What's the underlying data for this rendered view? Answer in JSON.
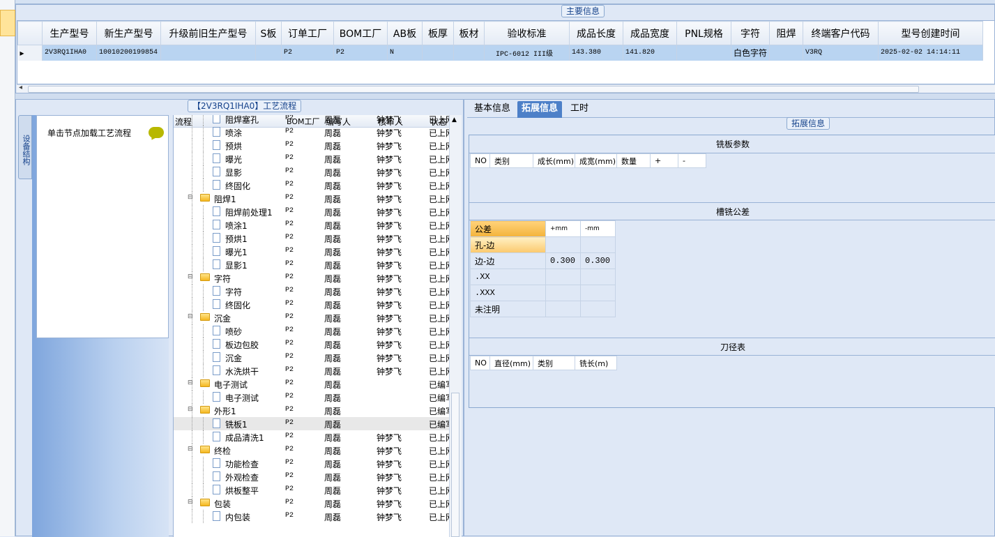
{
  "main_group_title": "主要信息",
  "grid": {
    "columns": [
      "生产型号",
      "新生产型号",
      "升级前旧生产型号",
      "S板",
      "订单工厂",
      "BOM工厂",
      "AB板",
      "板厚",
      "板材",
      "验收标准",
      "成品长度",
      "成品宽度",
      "PNL规格",
      "字符",
      "阻焊",
      "终端客户代码",
      "型号创建时间"
    ],
    "row": [
      "2V3RQ1IHA0",
      "10010200199854",
      "",
      "",
      "P2",
      "P2",
      "N",
      "",
      "",
      "IPC-6012 III级",
      "143.380",
      "141.820",
      "",
      "白色字符",
      "",
      "V3RQ",
      "2025-02-02 14:14:11"
    ]
  },
  "left": {
    "vtab_label": "设备结构",
    "load_hint": "单击节点加载工艺流程",
    "flow_title": "【2V3RQ1IHA0】工艺流程",
    "headers": {
      "flow": "流程",
      "bom": "BOM工厂",
      "writer": "编写人",
      "reviewer": "核审人",
      "status": "状态"
    },
    "rows": [
      {
        "name": "阻焊塞孔",
        "level": 2,
        "type": "doc",
        "bom": "P2",
        "writer": "周磊",
        "reviewer": "钟梦飞",
        "status": "已上网"
      },
      {
        "name": "喷涂",
        "level": 2,
        "type": "doc",
        "bom": "P2",
        "writer": "周磊",
        "reviewer": "钟梦飞",
        "status": "已上网"
      },
      {
        "name": "预烘",
        "level": 2,
        "type": "doc",
        "bom": "P2",
        "writer": "周磊",
        "reviewer": "钟梦飞",
        "status": "已上网"
      },
      {
        "name": "曝光",
        "level": 2,
        "type": "doc",
        "bom": "P2",
        "writer": "周磊",
        "reviewer": "钟梦飞",
        "status": "已上网"
      },
      {
        "name": "显影",
        "level": 2,
        "type": "doc",
        "bom": "P2",
        "writer": "周磊",
        "reviewer": "钟梦飞",
        "status": "已上网"
      },
      {
        "name": "终固化",
        "level": 2,
        "type": "doc",
        "bom": "P2",
        "writer": "周磊",
        "reviewer": "钟梦飞",
        "status": "已上网"
      },
      {
        "name": "阻焊1",
        "level": 1,
        "type": "folder",
        "bom": "P2",
        "writer": "周磊",
        "reviewer": "钟梦飞",
        "status": "已上网"
      },
      {
        "name": "阻焊前处理1",
        "level": 2,
        "type": "doc",
        "bom": "P2",
        "writer": "周磊",
        "reviewer": "钟梦飞",
        "status": "已上网"
      },
      {
        "name": "喷涂1",
        "level": 2,
        "type": "doc",
        "bom": "P2",
        "writer": "周磊",
        "reviewer": "钟梦飞",
        "status": "已上网"
      },
      {
        "name": "预烘1",
        "level": 2,
        "type": "doc",
        "bom": "P2",
        "writer": "周磊",
        "reviewer": "钟梦飞",
        "status": "已上网"
      },
      {
        "name": "曝光1",
        "level": 2,
        "type": "doc",
        "bom": "P2",
        "writer": "周磊",
        "reviewer": "钟梦飞",
        "status": "已上网"
      },
      {
        "name": "显影1",
        "level": 2,
        "type": "doc",
        "bom": "P2",
        "writer": "周磊",
        "reviewer": "钟梦飞",
        "status": "已上网"
      },
      {
        "name": "字符",
        "level": 1,
        "type": "folder",
        "bom": "P2",
        "writer": "周磊",
        "reviewer": "钟梦飞",
        "status": "已上网"
      },
      {
        "name": "字符",
        "level": 2,
        "type": "doc",
        "bom": "P2",
        "writer": "周磊",
        "reviewer": "钟梦飞",
        "status": "已上网"
      },
      {
        "name": "终固化",
        "level": 2,
        "type": "doc",
        "bom": "P2",
        "writer": "周磊",
        "reviewer": "钟梦飞",
        "status": "已上网"
      },
      {
        "name": "沉金",
        "level": 1,
        "type": "folder",
        "bom": "P2",
        "writer": "周磊",
        "reviewer": "钟梦飞",
        "status": "已上网"
      },
      {
        "name": "喷砂",
        "level": 2,
        "type": "doc",
        "bom": "P2",
        "writer": "周磊",
        "reviewer": "钟梦飞",
        "status": "已上网"
      },
      {
        "name": "板边包胶",
        "level": 2,
        "type": "doc",
        "bom": "P2",
        "writer": "周磊",
        "reviewer": "钟梦飞",
        "status": "已上网"
      },
      {
        "name": "沉金",
        "level": 2,
        "type": "doc",
        "bom": "P2",
        "writer": "周磊",
        "reviewer": "钟梦飞",
        "status": "已上网"
      },
      {
        "name": "水洗烘干",
        "level": 2,
        "type": "doc",
        "bom": "P2",
        "writer": "周磊",
        "reviewer": "钟梦飞",
        "status": "已上网"
      },
      {
        "name": "电子测试",
        "level": 1,
        "type": "folder",
        "bom": "P2",
        "writer": "周磊",
        "reviewer": "",
        "status": "已编写"
      },
      {
        "name": "电子测试",
        "level": 2,
        "type": "doc",
        "bom": "P2",
        "writer": "周磊",
        "reviewer": "",
        "status": "已编写"
      },
      {
        "name": "外形1",
        "level": 1,
        "type": "folder",
        "bom": "P2",
        "writer": "周磊",
        "reviewer": "",
        "status": "已编写"
      },
      {
        "name": "铣板1",
        "level": 2,
        "type": "doc",
        "bom": "P2",
        "writer": "周磊",
        "reviewer": "",
        "status": "已编写",
        "selected": true
      },
      {
        "name": "成品清洗1",
        "level": 2,
        "type": "doc",
        "bom": "P2",
        "writer": "周磊",
        "reviewer": "钟梦飞",
        "status": "已上网"
      },
      {
        "name": "终检",
        "level": 1,
        "type": "folder",
        "bom": "P2",
        "writer": "周磊",
        "reviewer": "钟梦飞",
        "status": "已上网"
      },
      {
        "name": "功能检查",
        "level": 2,
        "type": "doc",
        "bom": "P2",
        "writer": "周磊",
        "reviewer": "钟梦飞",
        "status": "已上网"
      },
      {
        "name": "外观检查",
        "level": 2,
        "type": "doc",
        "bom": "P2",
        "writer": "周磊",
        "reviewer": "钟梦飞",
        "status": "已上网"
      },
      {
        "name": "烘板整平",
        "level": 2,
        "type": "doc",
        "bom": "P2",
        "writer": "周磊",
        "reviewer": "钟梦飞",
        "status": "已上网"
      },
      {
        "name": "包装",
        "level": 1,
        "type": "folder",
        "bom": "P2",
        "writer": "周磊",
        "reviewer": "钟梦飞",
        "status": "已上网"
      },
      {
        "name": "内包装",
        "level": 2,
        "type": "doc",
        "bom": "P2",
        "writer": "周磊",
        "reviewer": "钟梦飞",
        "status": "已上网"
      }
    ]
  },
  "right": {
    "tabs": [
      "基本信息",
      "拓展信息",
      "工时"
    ],
    "active_tab": "拓展信息",
    "ext_title": "拓展信息",
    "milling": {
      "title": "铣板参数",
      "headers": [
        "NO",
        "类别",
        "成长(mm)",
        "成宽(mm)",
        "数量",
        "+",
        "-"
      ]
    },
    "tolerance": {
      "title": "槽铣公差",
      "headers": [
        "公差",
        "+mm",
        "-mm"
      ],
      "rows": [
        [
          "孔-边",
          "",
          ""
        ],
        [
          "边-边",
          "0.300",
          "0.300"
        ],
        [
          ".XX",
          "",
          ""
        ],
        [
          ".XXX",
          "",
          ""
        ],
        [
          "未注明",
          "",
          ""
        ]
      ]
    },
    "tools": {
      "title": "刀径表",
      "headers": [
        "NO",
        "直径(mm)",
        "类别",
        "铣长(m)"
      ]
    }
  }
}
